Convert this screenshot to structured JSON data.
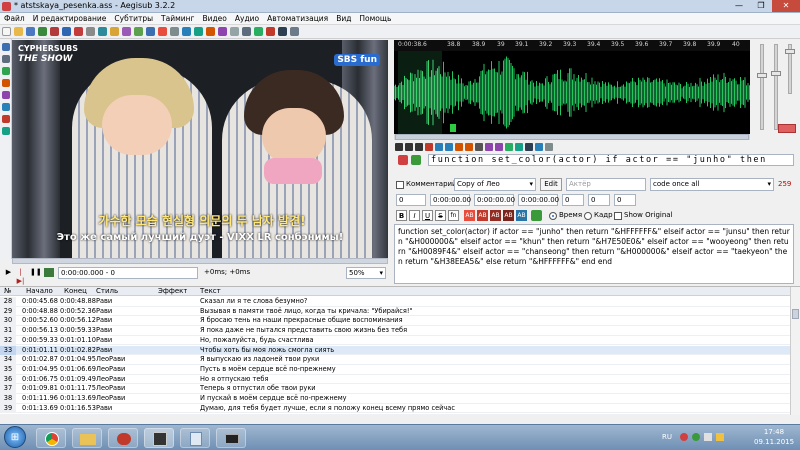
{
  "window": {
    "title": "* atstskaya_pesenka.ass - Aegisub 3.2.2",
    "min": "—",
    "max": "❐",
    "close": "✕"
  },
  "menu": [
    "Файл",
    "И редактирование",
    "Субтитры",
    "Тайминг",
    "Видео",
    "Аудио",
    "Автоматизация",
    "Вид",
    "Помощь"
  ],
  "video": {
    "logo_top": "CYPHERSUBS",
    "logo_show": "THE SHOW",
    "channel": "SBS fun",
    "korean_caption": "가수한 모습 현실형 의문의 두 남자 발견!",
    "ru_subtitle": "Это же самый лучший дуэт - VIXX LR сонбэнимы!",
    "time": "0:00:00.000 - 0",
    "offset": "+0ms; +0ms",
    "zoom": "50%"
  },
  "audio": {
    "ruler_marks": [
      "0:00:38.6",
      "38.8",
      "38.9",
      "39",
      "39.1",
      "39.2",
      "39.3",
      "39.4",
      "39.5",
      "39.6",
      "39.7",
      "39.8",
      "39.9",
      "40"
    ]
  },
  "automation": {
    "text": "function  set_color(actor)  if  actor  ==  \"junho\"  then"
  },
  "edit": {
    "comment_label": "Комментарий",
    "style": "Copy of Лео",
    "edit_button": "Edit",
    "actor_placeholder": "Актёр",
    "effect": "code once all",
    "char_count": "259",
    "layer": "0",
    "start": "0:00:00.00",
    "end": "0:00:00.00",
    "duration": "0:00:00.00",
    "margin_l": "0",
    "margin_r": "0",
    "margin_v": "0",
    "time_label": "Время",
    "frame_label": "Кадр",
    "show_original": "Show Original",
    "format_buttons": [
      "B",
      "I",
      "U",
      "S",
      "fn",
      "AB",
      "AB",
      "AB",
      "AB",
      "AB"
    ],
    "code_text": "function set_color(actor) if actor == \"junho\" then return \"&HFFFFFF&\" elseif actor == \"junsu\" then return \"&H000000&\" elseif actor == \"khun\" then return \"&H7E50E0&\" elseif actor == \"wooyeong\" then return \"&H0089F4&\" elseif actor == \"chanseong\" then return \"&H000000&\" elseif actor == \"taekyeon\" then return \"&H38EEA5&\" else return \"&HFFFFFF&\" end end"
  },
  "grid": {
    "headers": [
      "№",
      "Начало",
      "Конец",
      "Стиль",
      "Эффект",
      "Текст"
    ],
    "rows": [
      [
        "28",
        "0:00:45.68",
        "0:00:48.88",
        "Рави",
        "",
        "Сказал ли я те слова безумно?"
      ],
      [
        "29",
        "0:00:48.88",
        "0:00:52.36",
        "Рави",
        "",
        "Вызывая в памяти твоё лицо, когда ты кричала: \"Убирайся!\""
      ],
      [
        "30",
        "0:00:52.60",
        "0:00:56.12",
        "Рави",
        "",
        "Я бросаю тень на наши прекрасные общие воспоминания"
      ],
      [
        "31",
        "0:00:56.13",
        "0:00:59.33",
        "Рави",
        "",
        "Я пока даже не пытался представить свою жизнь без тебя"
      ],
      [
        "32",
        "0:00:59.33",
        "0:01:01.10",
        "Рави",
        "",
        "Но, пожалуйста, будь счастлива"
      ],
      [
        "33",
        "0:01:01.11",
        "0:01:02.82",
        "Рави",
        "",
        "Чтобы хоть бы моя ложь смогла сиять"
      ],
      [
        "34",
        "0:01:02.87",
        "0:01:04.95",
        "ЛеоРави",
        "",
        "Я выпускаю из ладоней твои руки"
      ],
      [
        "35",
        "0:01:04.95",
        "0:01:06.69",
        "ЛеоРави",
        "",
        "Пусть в моём сердце всё по-прежнему"
      ],
      [
        "36",
        "0:01:06.75",
        "0:01:09.49",
        "ЛеоРави",
        "",
        "Но я отпускаю тебя"
      ],
      [
        "37",
        "0:01:09.81",
        "0:01:11.75",
        "ЛеоРави",
        "",
        "Теперь я отпустил обе твои руки"
      ],
      [
        "38",
        "0:01:11.96",
        "0:01:13.69",
        "ЛеоРави",
        "",
        "И пускай в моём сердце всё по-прежнему"
      ],
      [
        "39",
        "0:01:13.69",
        "0:01:16.53",
        "Рави",
        "",
        "Думаю, для тебя будет лучше, если я положу конец всему прямо сейчас"
      ]
    ]
  },
  "taskbar": {
    "lang": "RU",
    "time": "17:48",
    "date": "09.11.2015"
  }
}
